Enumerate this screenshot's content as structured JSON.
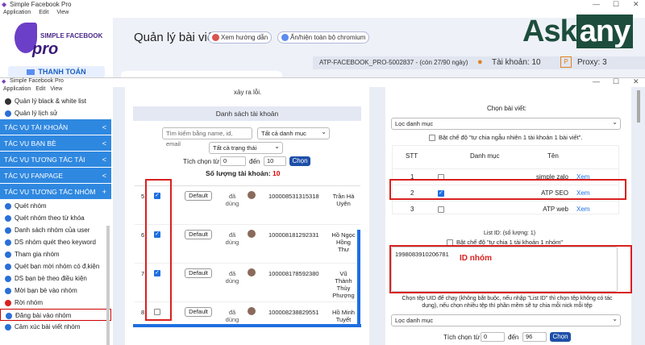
{
  "back_window": {
    "title": "Simple Facebook Pro",
    "menu": [
      "Application",
      "Edit",
      "View"
    ],
    "logo_text": "SIMPLE FACEBOOK",
    "logo_pro": "pro",
    "pay_button": "THANH TOÁN",
    "page_title": "Quản lý bài viết",
    "help_button": "Xem hướng dẫn",
    "toggle_button": "Ẩn/hiện toàn bộ chromium",
    "license": "ATP-FACEBOOK_PRO-5002837 - (còn 27/90 ngày)",
    "accounts": "Tài khoản: 10",
    "proxy": "Proxy: 3"
  },
  "brand": {
    "ask": "Ask",
    "any": "any"
  },
  "front_window": {
    "title": "Simple Facebook Pro",
    "menu": [
      "Application",
      "Edit",
      "View"
    ]
  },
  "sidebar": {
    "items": [
      {
        "type": "item",
        "label": "Quản lý black & white list",
        "icon": "circle-icon",
        "color": "#333"
      },
      {
        "type": "item",
        "label": "Quản lý lịch sử",
        "icon": "history-icon",
        "color": "#2a6fd8"
      },
      {
        "type": "section",
        "label": "TÁC VỤ TÀI KHOẢN",
        "arrow": "<"
      },
      {
        "type": "section",
        "label": "TÁC VỤ BẠN BÈ",
        "arrow": "<"
      },
      {
        "type": "section",
        "label": "TÁC VỤ TƯƠNG TÁC TÀI KHOẢN",
        "arrow": "<"
      },
      {
        "type": "section",
        "label": "TÁC VỤ FANPAGE",
        "arrow": "<"
      },
      {
        "type": "section",
        "label": "TÁC VỤ TƯƠNG TÁC NHÓM",
        "arrow": "+"
      },
      {
        "type": "item",
        "label": "Quét nhóm",
        "icon": "scan-icon",
        "color": "#2a6fd8"
      },
      {
        "type": "item",
        "label": "Quét nhóm theo từ khóa",
        "icon": "search-icon",
        "color": "#2a6fd8"
      },
      {
        "type": "item",
        "label": "Danh sách nhóm của user",
        "icon": "list-icon",
        "color": "#2a6fd8"
      },
      {
        "type": "item",
        "label": "DS nhóm quét theo keyword",
        "icon": "list-icon",
        "color": "#2a6fd8"
      },
      {
        "type": "item",
        "label": "Tham gia nhóm",
        "icon": "join-icon",
        "color": "#2a6fd8"
      },
      {
        "type": "item",
        "label": "Quét bạn mời nhóm có đ.kiện",
        "icon": "filter-icon",
        "color": "#2a6fd8"
      },
      {
        "type": "item",
        "label": "DS bạn bè theo điều kiện",
        "icon": "list-icon",
        "color": "#2a6fd8"
      },
      {
        "type": "item",
        "label": "Mời bạn bè vào nhóm",
        "icon": "invite-icon",
        "color": "#2a6fd8"
      },
      {
        "type": "item",
        "label": "Rời nhóm",
        "icon": "leave-icon",
        "color": "#d92020"
      },
      {
        "type": "item",
        "label": "Đăng bài vào nhóm",
        "icon": "post-icon",
        "color": "#2a6fd8",
        "selected": true
      },
      {
        "type": "item",
        "label": "Cảm xúc bài viết nhóm",
        "icon": "emoji-icon",
        "color": "#2a6fd8"
      }
    ]
  },
  "middle": {
    "error_tail": "xảy ra lỗi.",
    "section_title": "Danh sách tài khoản",
    "search_placeholder": "Tìm kiếm bằng name, id, email",
    "category_select": "Tất cả danh mục",
    "status_select": "Tất cả trạng thái",
    "pick_from": "Tích chọn từ",
    "from_val": "0",
    "to_label": "đến",
    "to_val": "10",
    "choose": "Chọn",
    "count_label": "Số lượng tài khoản:",
    "count": "10",
    "rows": [
      {
        "no": "5",
        "checked": true,
        "btn": "Default",
        "status": "đã dùng",
        "uid": "100008531315318",
        "name": "Trần Hà Uyên"
      },
      {
        "no": "6",
        "checked": true,
        "btn": "Default",
        "status": "đã dùng",
        "uid": "100008181292331",
        "name": "Hồ Ngọc Hồng Thư"
      },
      {
        "no": "7",
        "checked": true,
        "btn": "Default",
        "status": "đã dùng",
        "uid": "100008178592380",
        "name": "Vũ Thành Thùy Phượng"
      },
      {
        "no": "8",
        "checked": false,
        "btn": "Default",
        "status": "đã dùng",
        "uid": "100008238829551",
        "name": "Hồ Minh Tuyết"
      }
    ]
  },
  "right": {
    "pick_post_label": "Chọn bài viết:",
    "post_category": "Lọc danh mục",
    "random_note": "Bật chế độ \"tự chia ngẫu nhiên 1 tài khoản 1 bài viết\".",
    "cols": [
      "STT",
      "Danh mục",
      "Tên"
    ],
    "posts": [
      {
        "stt": "1",
        "checked": false,
        "name": "simple zalo",
        "link": "Xem"
      },
      {
        "stt": "2",
        "checked": true,
        "name": "ATP SEO",
        "link": "Xem"
      },
      {
        "stt": "3",
        "checked": false,
        "name": "ATP web",
        "link": "Xem"
      }
    ],
    "list_id_label": "List ID: (số lượng: 1)",
    "split_note": "Bật chế độ \"tự chia 1 tài khoản 1 nhóm\"",
    "id_value": "1998083910206781",
    "id_annotation": "ID nhóm",
    "uid_note": "Chọn tệp UID để chạy (không bắt buộc, nếu nhập \"List ID\" thì chọn tệp không có tác dụng), nếu chọn nhiều tệp thì phần mềm sẽ tự chia mỗi nick mỗi tệp",
    "file_category": "Lọc danh mục",
    "pick_from": "Tích chọn từ",
    "from_val": "0",
    "to_label": "đến",
    "to_val": "96",
    "choose": "Chọn"
  }
}
